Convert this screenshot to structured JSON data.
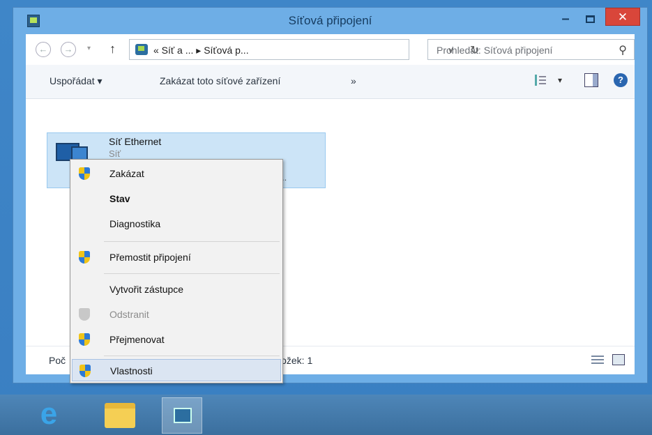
{
  "window": {
    "title": "Síťová připojení",
    "minimize_glyph": "–",
    "close_glyph": "✕"
  },
  "nav": {
    "back_glyph": "←",
    "forward_glyph": "→",
    "recent_glyph": "▾",
    "up_glyph": "↑",
    "address": "« Síť a ...  ▸  Síťová p...",
    "address_dropdown": "∨",
    "refresh_glyph": "↻",
    "search_placeholder": "Prohledat: Síťová připojení",
    "search_glyph": "⚲"
  },
  "toolbar": {
    "organize": "Uspořádat ▾",
    "disable_device": "Zakázat toto síťové zařízení",
    "more": "»",
    "view_dropdown": "▾",
    "help_glyph": "?"
  },
  "network_item": {
    "name": "Síť Ethernet",
    "sub": "Síť",
    "adapter_partial": "ér p..."
  },
  "status": {
    "left": "Poč",
    "right": "ložek: 1"
  },
  "context_menu": {
    "items": [
      {
        "label": "Zakázat",
        "shield": true,
        "bold": false,
        "disabled": false
      },
      {
        "label": "Stav",
        "shield": false,
        "bold": true,
        "disabled": false
      },
      {
        "label": "Diagnostika",
        "shield": false,
        "bold": false,
        "disabled": false
      },
      {
        "label": "Přemostit připojení",
        "shield": true,
        "bold": false,
        "disabled": false
      },
      {
        "label": "Vytvořit zástupce",
        "shield": false,
        "bold": false,
        "disabled": false
      },
      {
        "label": "Odstranit",
        "shield": true,
        "bold": false,
        "disabled": true
      },
      {
        "label": "Přejmenovat",
        "shield": true,
        "bold": false,
        "disabled": false
      },
      {
        "label": "Vlastnosti",
        "shield": true,
        "bold": false,
        "disabled": false,
        "hover": true
      }
    ]
  },
  "taskbar": {
    "ie_glyph": "e"
  }
}
